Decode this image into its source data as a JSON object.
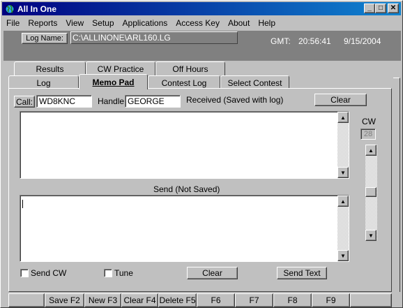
{
  "window": {
    "title": "All In One"
  },
  "menu": [
    "File",
    "Reports",
    "View",
    "Setup",
    "Applications",
    "Access Key",
    "About",
    "Help"
  ],
  "header": {
    "log_name_label": "Log Name:",
    "log_path": "C:\\ALLINONE\\ARL160.LG",
    "gmt_label": "GMT:",
    "time": "20:56:41",
    "date": "9/15/2004"
  },
  "tabs_back": [
    "Results",
    "CW Practice",
    "Off Hours"
  ],
  "tabs_front": [
    "Log",
    "Memo Pad",
    "Contest Log",
    "Select Contest"
  ],
  "memo": {
    "call_label": "Call:",
    "call_value": "WD8KNC",
    "handle_label": "Handle:",
    "handle_value": "GEORGE",
    "received_label": "Received (Saved with log)",
    "clear_top": "Clear",
    "cw_label": "CW",
    "cw_value": "28",
    "send_label": "Send (Not Saved)",
    "send_cw_label": "Send CW",
    "tune_label": "Tune",
    "clear_bottom": "Clear",
    "send_text": "Send Text"
  },
  "fkeys": [
    "",
    "Save F2",
    "New F3",
    "Clear F4",
    "Delete F5",
    "F6",
    "F7",
    "F8",
    "F9",
    ""
  ]
}
